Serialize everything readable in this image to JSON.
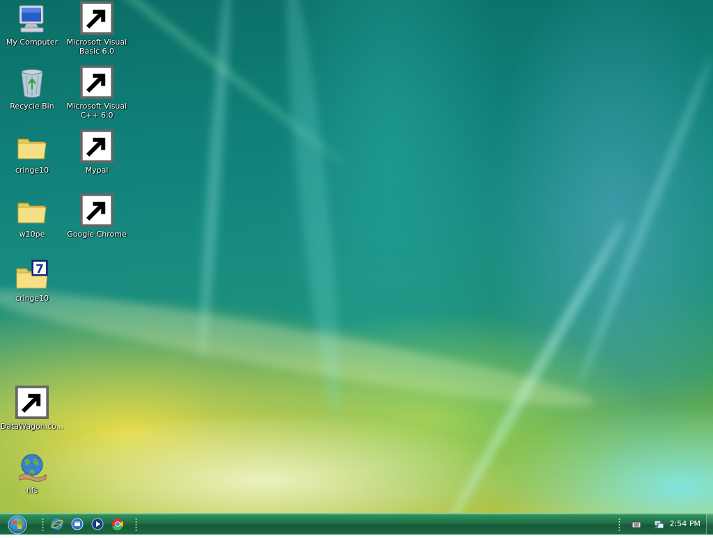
{
  "desktop": {
    "icons": [
      {
        "label": "My Computer",
        "icon": "computer-icon",
        "shortcut": false
      },
      {
        "label": "Microsoft Visual Basic 6.0",
        "icon": "visual-basic-icon",
        "shortcut": true
      },
      {
        "label": "Recycle Bin",
        "icon": "recycle-bin-icon",
        "shortcut": false
      },
      {
        "label": "Microsoft Visual C++ 6.0",
        "icon": "visual-cpp-icon",
        "shortcut": true
      },
      {
        "label": "cringe10",
        "icon": "folder-icon",
        "shortcut": false
      },
      {
        "label": "Mypal",
        "icon": "mypal-raccoon-icon",
        "shortcut": true
      },
      {
        "label": "w10pe",
        "icon": "folder-icon",
        "shortcut": false
      },
      {
        "label": "Google Chrome",
        "icon": "chrome-icon",
        "shortcut": true
      },
      {
        "label": "cringe10",
        "icon": "seven-zip-archive-icon",
        "shortcut": false
      },
      {
        "label": "DataWagon.co...",
        "icon": "datawagon-icon",
        "shortcut": true
      },
      {
        "label": "hfs",
        "icon": "hfs-globe-icon",
        "shortcut": false
      }
    ]
  },
  "taskbar": {
    "start_icon": "windows-orb-icon",
    "quick_launch": [
      {
        "name": "internet-explorer-icon"
      },
      {
        "name": "show-desktop-ql-icon"
      },
      {
        "name": "media-player-icon"
      },
      {
        "name": "chrome-ql-icon"
      }
    ],
    "tray": {
      "icons": [
        "keyboard-icon",
        "network-icon"
      ],
      "clock": "2:54 PM"
    }
  },
  "colors": {
    "taskbar_top": "#5bb37d",
    "taskbar_bottom": "#165a38",
    "label_text": "#ffffff",
    "wallpaper_teal": "#0f7f77",
    "wallpaper_yellow": "#e6d640"
  }
}
